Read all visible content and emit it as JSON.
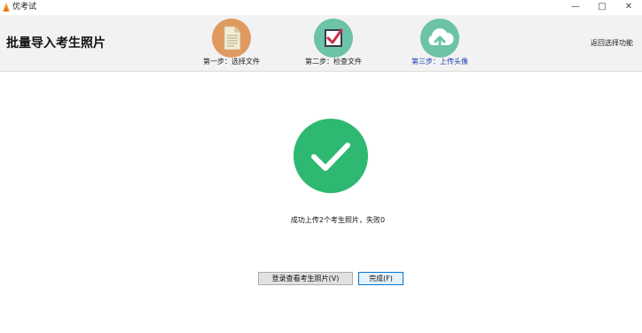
{
  "window": {
    "title": "优考试",
    "minimize": "—",
    "maximize": "□",
    "close": "✕"
  },
  "header": {
    "page_title": "批量导入考生照片",
    "back_link": "返回选择功能",
    "steps": [
      {
        "label": "第一步：选择文件",
        "icon": "document-icon",
        "color": "#e09a5f"
      },
      {
        "label": "第二步：检查文件",
        "icon": "checkbox-icon",
        "color": "#6cc3a6"
      },
      {
        "label": "第三步：上传头像",
        "icon": "cloud-upload-icon",
        "color": "#6cc3a6",
        "active": true
      }
    ]
  },
  "main": {
    "success_icon": "checkmark-icon",
    "success_color": "#2eb871",
    "message": "成功上传2个考生照片，失败0",
    "buttons": {
      "view_label": "登录查看考生照片(V)",
      "done_label": "完成(F)"
    }
  }
}
